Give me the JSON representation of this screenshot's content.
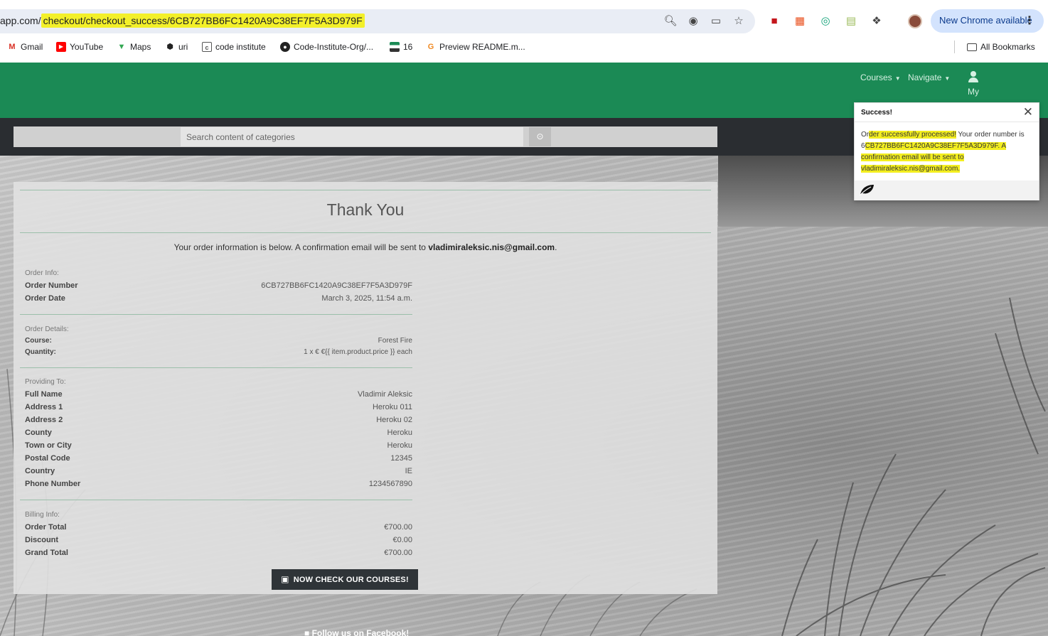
{
  "browser": {
    "url_prefix": "app.com/",
    "url_path": "checkout/checkout_success/6CB727BB6FC1420A9C38EF7F5A3D979F",
    "new_chrome_label": "New Chrome available",
    "bookmarks": [
      {
        "label": "Gmail",
        "icon": "gmail-icon"
      },
      {
        "label": "YouTube",
        "icon": "youtube-icon"
      },
      {
        "label": "Maps",
        "icon": "maps-icon"
      },
      {
        "label": "uri",
        "icon": "uri-icon"
      },
      {
        "label": "code institute",
        "icon": "code-institute-icon"
      },
      {
        "label": "Code-Institute-Org/...",
        "icon": "github-icon"
      },
      {
        "label": "16",
        "icon": "flag-icon"
      },
      {
        "label": "Preview README.m...",
        "icon": "preview-icon"
      }
    ],
    "all_bookmarks_label": "All Bookmarks"
  },
  "nav": {
    "courses": "Courses",
    "navigate": "Navigate",
    "my": "My"
  },
  "search": {
    "placeholder": "Search content of categories"
  },
  "page": {
    "title": "Thank You",
    "info_text": "Your order information is below. A confirmation email will be sent to ",
    "info_email": "vladimiraleksic.nis@gmail.com",
    "info_end": ".",
    "order_info_label": "Order Info:",
    "order_number_label": "Order Number",
    "order_number": "6CB727BB6FC1420A9C38EF7F5A3D979F",
    "order_date_label": "Order Date",
    "order_date": "March 3, 2025, 11:54 a.m.",
    "order_details_label": "Order Details:",
    "course_label": "Course:",
    "course_value": "Forest Fire",
    "quantity_label": "Quantity:",
    "quantity_value": "1 x  € €{{ item.product.price }} each",
    "providing_label": "Providing To:",
    "full_name_label": "Full Name",
    "full_name": "Vladimir Aleksic",
    "address1_label": "Address 1",
    "address1": "Heroku 011",
    "address2_label": "Address 2",
    "address2": "Heroku 02",
    "county_label": "County",
    "county": "Heroku",
    "town_label": "Town or City",
    "town": "Heroku",
    "postal_label": "Postal Code",
    "postal": "12345",
    "country_label": "Country",
    "country": "IE",
    "phone_label": "Phone Number",
    "phone": "1234567890",
    "billing_label": "Billing Info:",
    "order_total_label": "Order Total",
    "order_total": "€700.00",
    "discount_label": "Discount",
    "discount": "€0.00",
    "grand_total_label": "Grand Total",
    "grand_total": "€700.00",
    "courses_button": "NOW CHECK OUR COURSES!"
  },
  "footer": {
    "follow": "Follow us on Facebook!"
  },
  "toast": {
    "title": "Success!",
    "msg_start": "Or",
    "msg_hl1": "der successfully processed!",
    "msg_mid": " Your order number is 6",
    "msg_hl2": "CB727BB6FC1420A9C38EF7F5A3D979F. A confirmation email will be sent to vladimiraleksic.nis@gmail.com.",
    "close_icon": "close-icon",
    "leaf_icon": "leaf-icon"
  },
  "colors": {
    "navbar": "#1b8a55",
    "highlight": "#f3f02a",
    "search_strip": "#2a2d31"
  }
}
